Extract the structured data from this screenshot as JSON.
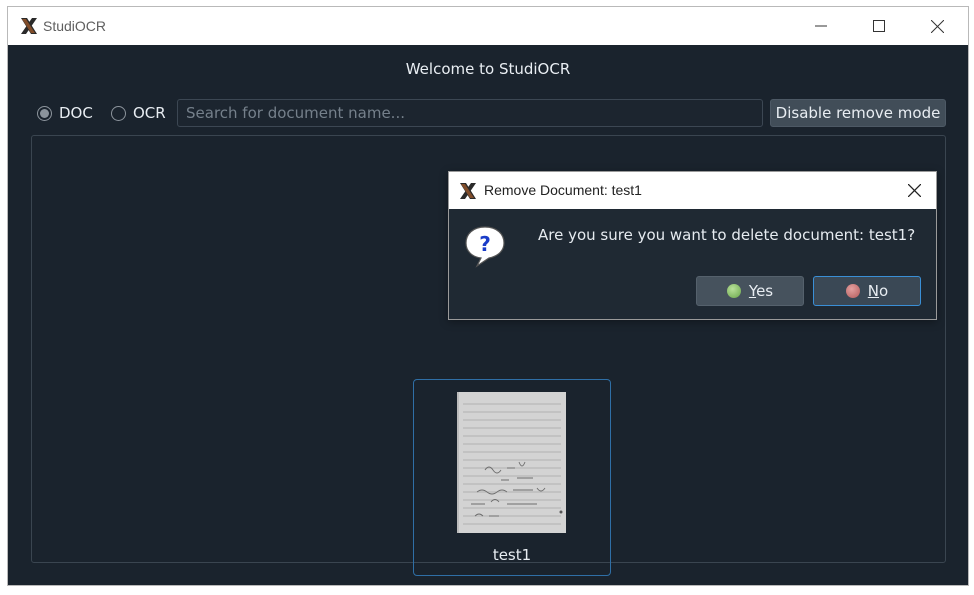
{
  "window": {
    "title": "StudiOCR",
    "controls": {
      "minimize": "minimize-icon",
      "maximize": "maximize-icon",
      "close": "close-icon"
    }
  },
  "main": {
    "welcome": "Welcome to StudiOCR",
    "mode_options": [
      {
        "label": "DOC",
        "selected": true
      },
      {
        "label": "OCR",
        "selected": false
      }
    ],
    "search": {
      "placeholder": "Search for document name...",
      "value": ""
    },
    "disable_remove_button": "Disable remove mode",
    "documents": [
      {
        "name": "test1"
      }
    ]
  },
  "dialog": {
    "title": "Remove Document: test1",
    "message": "Are you sure you want to delete document: test1?",
    "icon": "question-icon",
    "buttons": {
      "yes": {
        "mnemonic": "Y",
        "rest": "es"
      },
      "no": {
        "mnemonic": "N",
        "rest": "o"
      }
    }
  },
  "colors": {
    "background": "#1a232d",
    "accent": "#3a8fd6",
    "button": "#414d58"
  }
}
